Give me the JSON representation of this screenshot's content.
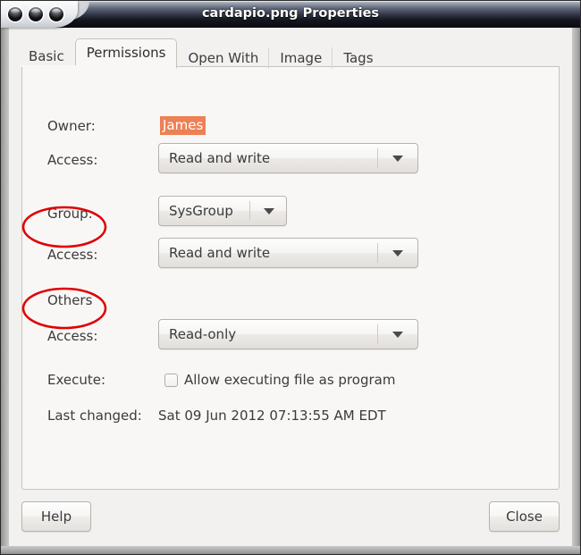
{
  "window": {
    "title": "cardapio.png Properties",
    "controls": [
      {
        "name": "close-button"
      },
      {
        "name": "minimize-button"
      },
      {
        "name": "maximize-button"
      }
    ]
  },
  "tabs": [
    {
      "label": "Basic",
      "active": false
    },
    {
      "label": "Permissions",
      "active": true
    },
    {
      "label": "Open With",
      "active": false
    },
    {
      "label": "Image",
      "active": false
    },
    {
      "label": "Tags",
      "active": false
    }
  ],
  "permissions": {
    "owner": {
      "label": "Owner:",
      "value": "James",
      "highlight_color": "#ed8055",
      "access_label": "Access:",
      "access_value": "Read and write"
    },
    "group": {
      "label": "Group:",
      "value": "SysGroup",
      "access_label": "Access:",
      "access_value": "Read and write"
    },
    "others": {
      "label": "Others",
      "access_label": "Access:",
      "access_value": "Read-only"
    },
    "execute": {
      "label": "Execute:",
      "checkbox_label": "Allow executing file as program",
      "checked": false
    },
    "last_changed": {
      "label": "Last changed:",
      "value": "Sat 09 Jun 2012 07:13:55 AM EDT"
    }
  },
  "footer": {
    "help_label": "Help",
    "close_label": "Close"
  },
  "annotations": {
    "color": "#e00000",
    "items": [
      {
        "name": "group-access-highlight",
        "target": "Access:"
      },
      {
        "name": "others-access-highlight",
        "target": "Access:"
      }
    ]
  }
}
